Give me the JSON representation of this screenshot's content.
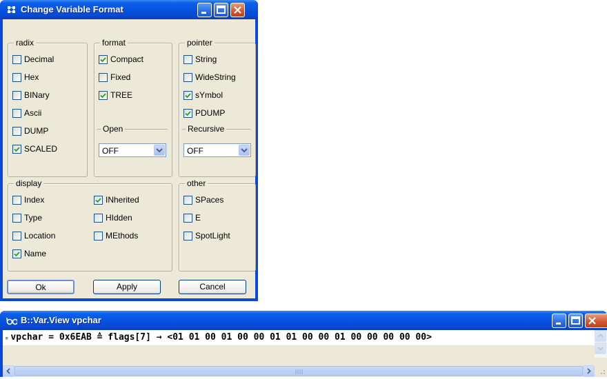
{
  "dialog": {
    "title": "Change Variable Format",
    "groups": {
      "radix": {
        "label": "radix",
        "items": [
          {
            "label": "Decimal",
            "checked": false
          },
          {
            "label": "Hex",
            "checked": false
          },
          {
            "label": "BINary",
            "checked": false
          },
          {
            "label": "Ascii",
            "checked": false
          },
          {
            "label": "DUMP",
            "checked": false
          },
          {
            "label": "SCALED",
            "checked": true
          }
        ]
      },
      "format": {
        "label": "format",
        "items": [
          {
            "label": "Compact",
            "checked": true
          },
          {
            "label": "Fixed",
            "checked": false
          },
          {
            "label": "TREE",
            "checked": true
          }
        ]
      },
      "open": {
        "label": "Open",
        "value": "OFF"
      },
      "pointer": {
        "label": "pointer",
        "items": [
          {
            "label": "String",
            "checked": false
          },
          {
            "label": "WideString",
            "checked": false
          },
          {
            "label": "sYmbol",
            "checked": true
          },
          {
            "label": "PDUMP",
            "checked": true
          }
        ]
      },
      "recursive": {
        "label": "Recursive",
        "value": "OFF"
      },
      "display": {
        "label": "display",
        "items": [
          {
            "label": "Index",
            "checked": false
          },
          {
            "label": "Type",
            "checked": false
          },
          {
            "label": "Location",
            "checked": false
          },
          {
            "label": "Name",
            "checked": true
          },
          {
            "label": "INherited",
            "checked": true
          },
          {
            "label": "HIdden",
            "checked": false
          },
          {
            "label": "MEthods",
            "checked": false
          }
        ]
      },
      "other": {
        "label": "other",
        "items": [
          {
            "label": "SPaces",
            "checked": false
          },
          {
            "label": "E",
            "checked": false
          },
          {
            "label": "SpotLight",
            "checked": false
          }
        ]
      }
    },
    "buttons": {
      "ok": "Ok",
      "apply": "Apply",
      "cancel": "Cancel"
    }
  },
  "varview": {
    "title": "B::Var.View vpchar",
    "bullet": "▪",
    "line": "vpchar = 0x6EAB ≙ flags[7] → <01 01 00 01 00 00 01 01 00 00 01 00 00 00 00 00>"
  },
  "colors": {
    "titlebar": "#0552df",
    "face": "#ece9d8",
    "close_button": "#d45a33"
  }
}
